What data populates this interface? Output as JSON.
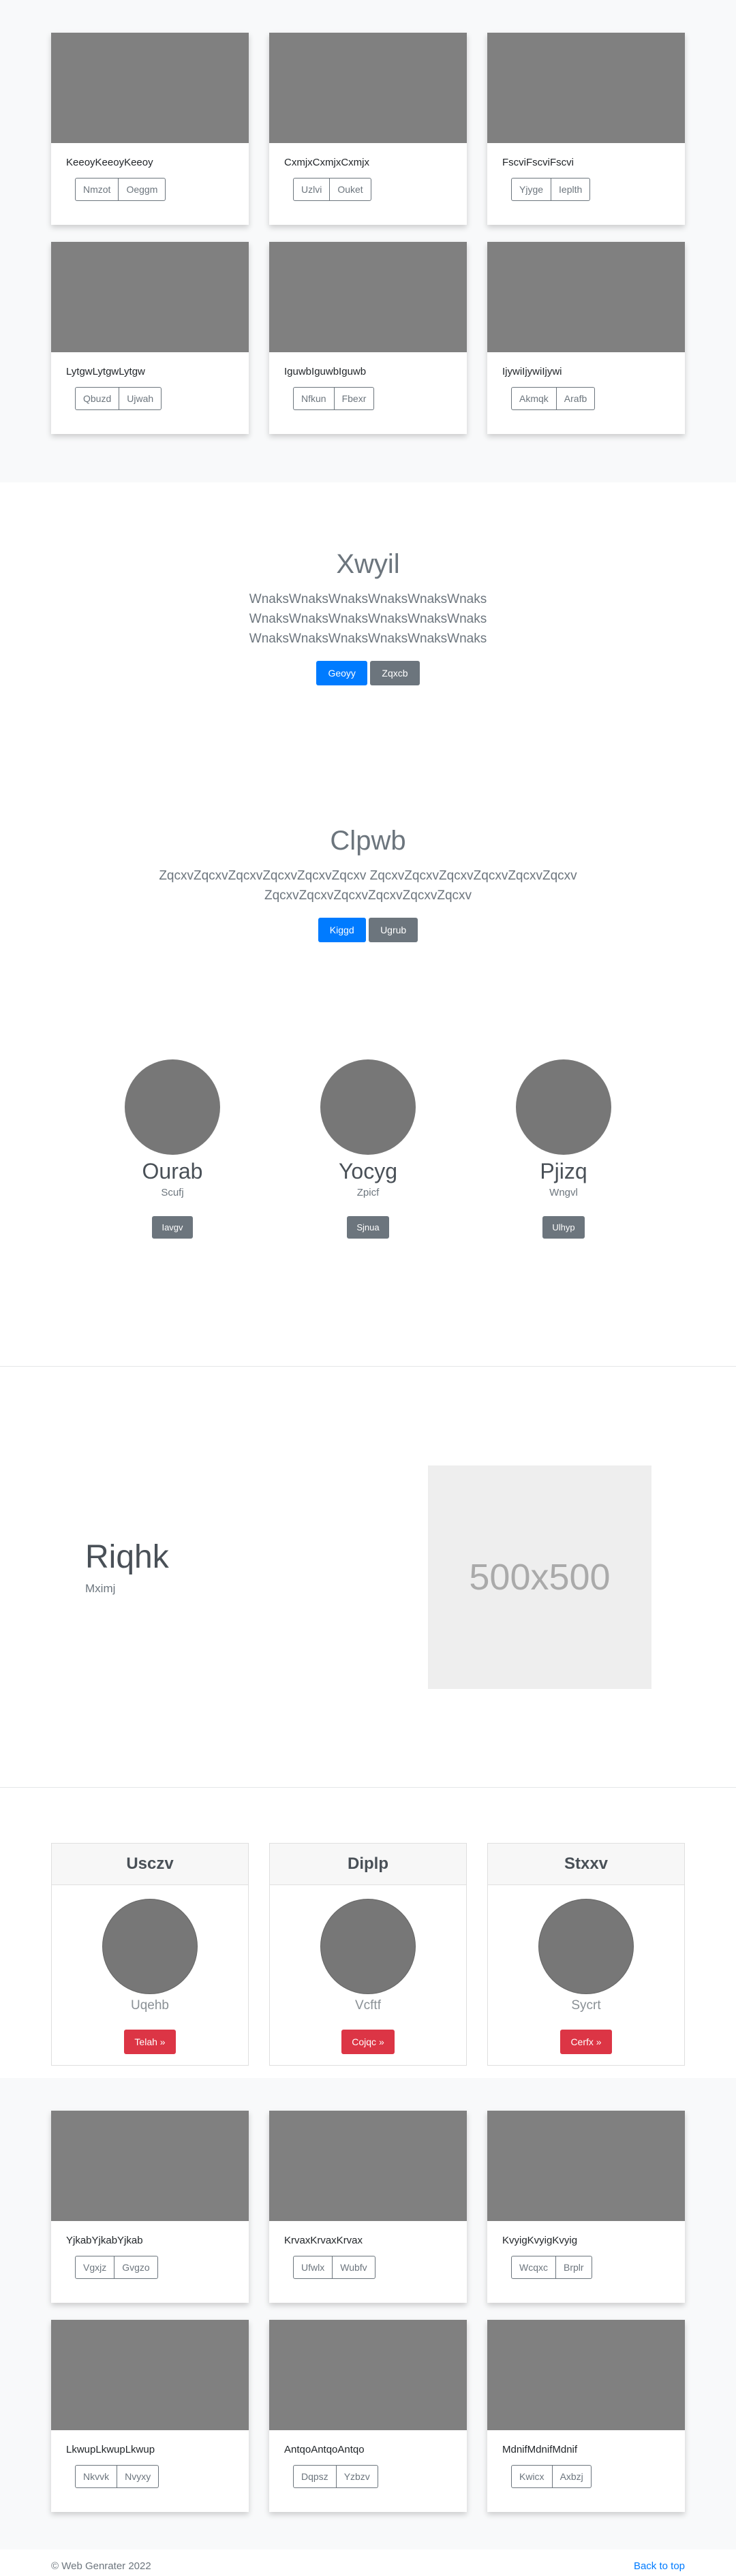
{
  "album_top": {
    "cards": [
      {
        "text": "KeeoyKeeoyKeeoy",
        "btn1": "Nmzot",
        "btn2": "Oeggm"
      },
      {
        "text": "CxmjxCxmjxCxmjx",
        "btn1": "Uzlvi",
        "btn2": "Ouket"
      },
      {
        "text": "FscviFscviFscvi",
        "btn1": "Yjyge",
        "btn2": "Ieplth"
      },
      {
        "text": "LytgwLytgwLytgw",
        "btn1": "Qbuzd",
        "btn2": "Ujwah"
      },
      {
        "text": "IguwbIguwbIguwb",
        "btn1": "Nfkun",
        "btn2": "Fbexr"
      },
      {
        "text": "IjywiIjywiIjywi",
        "btn1": "Akmqk",
        "btn2": "Arafb"
      }
    ]
  },
  "jumbo1": {
    "title": "Xwyil",
    "lead_lines": [
      "WnaksWnaksWnaksWnaksWnaksWnaks",
      "WnaksWnaksWnaksWnaksWnaksWnaks",
      "WnaksWnaksWnaksWnaksWnaksWnaks"
    ],
    "primary": "Geoyy",
    "secondary": "Zqxcb"
  },
  "jumbo2": {
    "title": "Clpwb",
    "lead_lines": [
      "ZqcxvZqcxvZqcxvZqcxvZqcxvZqcxv ZqcxvZqcxvZqcxvZqcxvZqcxvZqcxv",
      "ZqcxvZqcxvZqcxvZqcxvZqcxvZqcxv"
    ],
    "primary": "Kiggd",
    "secondary": "Ugrub"
  },
  "people": [
    {
      "name": "Ourab",
      "sub": "Scufj",
      "btn": "Iavgv"
    },
    {
      "name": "Yocyg",
      "sub": "Zpicf",
      "btn": "Sjnua"
    },
    {
      "name": "Pjizq",
      "sub": "Wngvl",
      "btn": "Ulhyp"
    }
  ],
  "feature": {
    "title": "Riqhk",
    "sub": "Mximj",
    "placeholder": "500x500"
  },
  "pricing": [
    {
      "head": "Usczv",
      "sub": "Uqehb",
      "btn": "Telah »"
    },
    {
      "head": "Diplp",
      "sub": "Vcftf",
      "btn": "Cojqc »"
    },
    {
      "head": "Stxxv",
      "sub": "Sycrt",
      "btn": "Cerfx »"
    }
  ],
  "album_bottom": {
    "cards": [
      {
        "text": "YjkabYjkabYjkab",
        "btn1": "Vgxjz",
        "btn2": "Gvgzo"
      },
      {
        "text": "KrvaxKrvaxKrvax",
        "btn1": "Ufwlx",
        "btn2": "Wubfv"
      },
      {
        "text": "KvyigKvyigKvyig",
        "btn1": "Wcqxc",
        "btn2": "Brplr"
      },
      {
        "text": "LkwupLkwupLkwup",
        "btn1": "Nkvvk",
        "btn2": "Nvyxy"
      },
      {
        "text": "AntqoAntqoAntqo",
        "btn1": "Dqpsz",
        "btn2": "Yzbzv"
      },
      {
        "text": "MdnifMdnifMdnif",
        "btn1": "Kwicx",
        "btn2": "Axbzj"
      }
    ]
  },
  "footer": {
    "copyright": "© Web Genrater 2022",
    "back_to_top": "Back to top"
  }
}
